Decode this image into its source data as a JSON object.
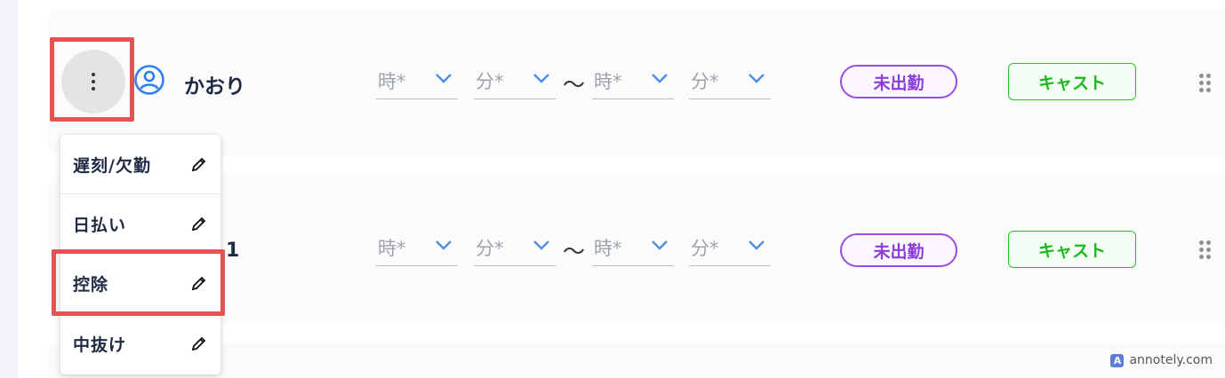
{
  "rows": [
    {
      "name": "かおり",
      "start_hour": {
        "placeholder": "時*"
      },
      "start_minute": {
        "placeholder": "分*"
      },
      "separator": "〜",
      "end_hour": {
        "placeholder": "時*"
      },
      "end_minute": {
        "placeholder": "分*"
      },
      "status_label": "未出勤",
      "role_label": "キャスト"
    },
    {
      "name_partial": "1",
      "start_hour": {
        "placeholder": "時*"
      },
      "start_minute": {
        "placeholder": "分*"
      },
      "separator": "〜",
      "end_hour": {
        "placeholder": "時*"
      },
      "end_minute": {
        "placeholder": "分*"
      },
      "status_label": "未出勤",
      "role_label": "キャスト"
    }
  ],
  "menu": {
    "items": [
      {
        "label": "遅刻/欠勤",
        "icon": "pencil-icon"
      },
      {
        "label": "日払い",
        "icon": "pencil-icon"
      },
      {
        "label": "控除",
        "icon": "pencil-icon"
      },
      {
        "label": "中抜け",
        "icon": "pencil-icon"
      }
    ]
  },
  "watermark": {
    "text": "annotely.com",
    "logo": "A"
  },
  "colors": {
    "status_purple": "#9b4de3",
    "cast_green": "#27c227",
    "highlight_red": "#e05454",
    "chevron_blue": "#4a8fe7",
    "user_icon_blue": "#2f7ff0"
  }
}
